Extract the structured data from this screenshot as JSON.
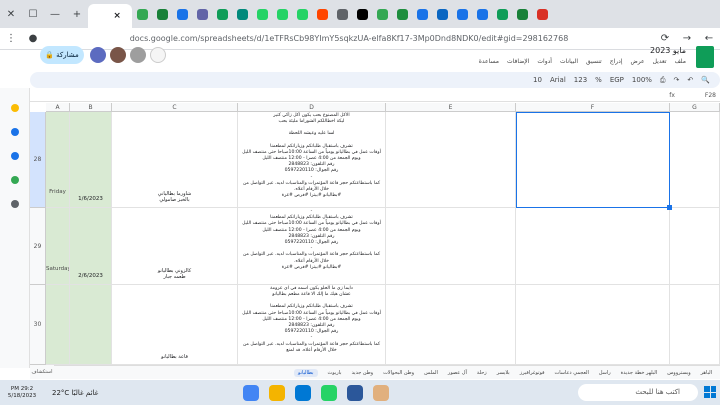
{
  "browser": {
    "url": "docs.google.com/spreadsheets/d/1eTFRsCb98YImY5sqkzUA-elfa8Kf17-3Mp0Dnd8NDK0/edit#gid=298162768",
    "tab_colors": [
      "#0f9d58",
      "#34a853",
      "#188038",
      "#1a73e8",
      "#6264a7",
      "#0f9d58",
      "#00897b",
      "#25d366",
      "#25d366",
      "#25d366",
      "#ff4500",
      "#5f6368",
      "#000000",
      "#34a853",
      "#1e8e3e",
      "#1a73e8",
      "#0a66c2",
      "#1a73e8",
      "#1a73e8",
      "#0f9d58",
      "#188038",
      "#d93025"
    ]
  },
  "doc": {
    "title": "مايو 2023",
    "menus": [
      "ملف",
      "تعديل",
      "عرض",
      "إدراج",
      "تنسيق",
      "البيانات",
      "أدوات",
      "الإضافات",
      "مساعدة"
    ],
    "share_label": "مشاركة"
  },
  "toolbar": {
    "zoom": "100%",
    "currency": "EGP",
    "percent": "%",
    "number_format": "123",
    "font": "Arial",
    "font_size": "10"
  },
  "formula_bar": {
    "cell_ref": "F28",
    "fx": "fx"
  },
  "columns": [
    "A",
    "B",
    "C",
    "D",
    "E",
    "F",
    "G"
  ],
  "rows": [
    {
      "num": "28",
      "day": "Friday",
      "date": "1/6/2023",
      "col_c": "شاورما بطالياني\nبالخبز صامولي",
      "lines": [
        "الاكل المصنوع بحب يكون اكل زاكي كتير",
        "ليكة اخطاللكم الشوراما مليئة بحب",
        "",
        "لسا عليه وعيشه اللحظة",
        "",
        "تشرف باستقبال طلباتكم وزياراتكم لمطعمنا",
        "أوقات عمل في بطاليانو يومياً من الساعة 10:00صباحا حتى منتصف الليل",
        "ويوم الجمعة من 4:00 عصرا - 12:00 منتصف الليل",
        "رقم التلفون: 2848823",
        "رقم الجوال: 0597220110",
        "-",
        "كما باستطاعتكم حجز قاعة المؤتمرات والمناسبات لديه. عبر التواصل من خلال الأرقام أعلاه.",
        "#بطاليانو #بيتزا #فرص #غزة"
      ]
    },
    {
      "num": "29",
      "day": "Saturday",
      "date": "2/6/2023",
      "col_c": "كالزوني بطاليانو\nطعمه جبار",
      "lines": [
        "-",
        "تشرف باستقبال طلباتكم وزياراتكم لمطعمنا",
        "أوقات عمل في بطاليانو يومياً من الساعة 10:00صباحا حتى منتصف الليل",
        "ويوم الجمعة من 4:00 عصرا - 12:00 منتصف الليل",
        "رقم التلفون: 2848823",
        "رقم الجوال: 0597220110",
        "-",
        "كما باستطاعتكم حجز قاعة المؤتمرات والمناسبات لديه. عبر التواصل من خلال الأرقام أعلاه.",
        "#بطاليانو #بيتزا #فرص #غزة"
      ]
    },
    {
      "num": "30",
      "day": "",
      "date": "",
      "col_c": "قاعة بطاليانو",
      "lines": [
        "دايما زي ما الحلو يكون اسمه في اي عزومة",
        "عشان هيك ما إلك الا قاعة مطعم بطاليانو",
        "",
        "تشرف باستقبال طلباتكم وزياراتكم لمطعمنا",
        "أوقات عمل في بطاليانو يومياً من الساعة 10:00صباحا حتى منتصف الليل",
        "ويوم الجمعة من 4:00 عصرا - 12:00 منتصف الليل",
        "رقم التلفون: 2848823",
        "رقم الجوال: 0597220110",
        "-",
        "كما باستطاعتكم حجز قاعة المؤتمرات والمناسبات لديه. عبر التواصل من خلال الأرقام أعلاه. قد لمنع"
      ]
    }
  ],
  "sheet_tabs": [
    "الباهر",
    "ويسترووس",
    "البلهر خطة جديدة",
    "راسل",
    "العجمي دعاسات",
    "فوتوغرافيرز",
    "بلايسر",
    "زحلة",
    "آل عصور",
    "الملس",
    "وطن البحوالات",
    "وطن جديد",
    "باريوث",
    "بطاليانو"
  ],
  "sheet_active": "بطاليانو",
  "explore_label": "استكشاف",
  "taskbar": {
    "time": "PM 29:2",
    "date": "5/18/2023",
    "weather": "22°C  غائم غالبًا",
    "search_placeholder": "اكتب هنا للبحث"
  }
}
